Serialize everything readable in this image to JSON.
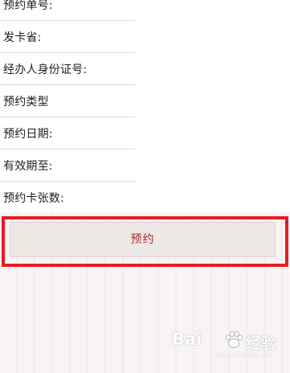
{
  "form": {
    "fields": [
      {
        "label": "预约单号:"
      },
      {
        "label": "发卡省:"
      },
      {
        "label": "经办人身份证号:"
      },
      {
        "label": "预约类型"
      },
      {
        "label": "预约日期:"
      },
      {
        "label": "有效期至:"
      },
      {
        "label": "预约卡张数:"
      }
    ]
  },
  "actions": {
    "reserve_label": "预约"
  },
  "highlight": {
    "color": "#e81c24"
  },
  "watermark": {
    "text": "Bai",
    "text2": "经验",
    "url": "jingyan.baidu.com",
    "icon": "baidu-paw-icon"
  },
  "colors": {
    "button_text": "#b5292a",
    "button_bg": "#ece8e6",
    "background": "#f6f1f1"
  }
}
